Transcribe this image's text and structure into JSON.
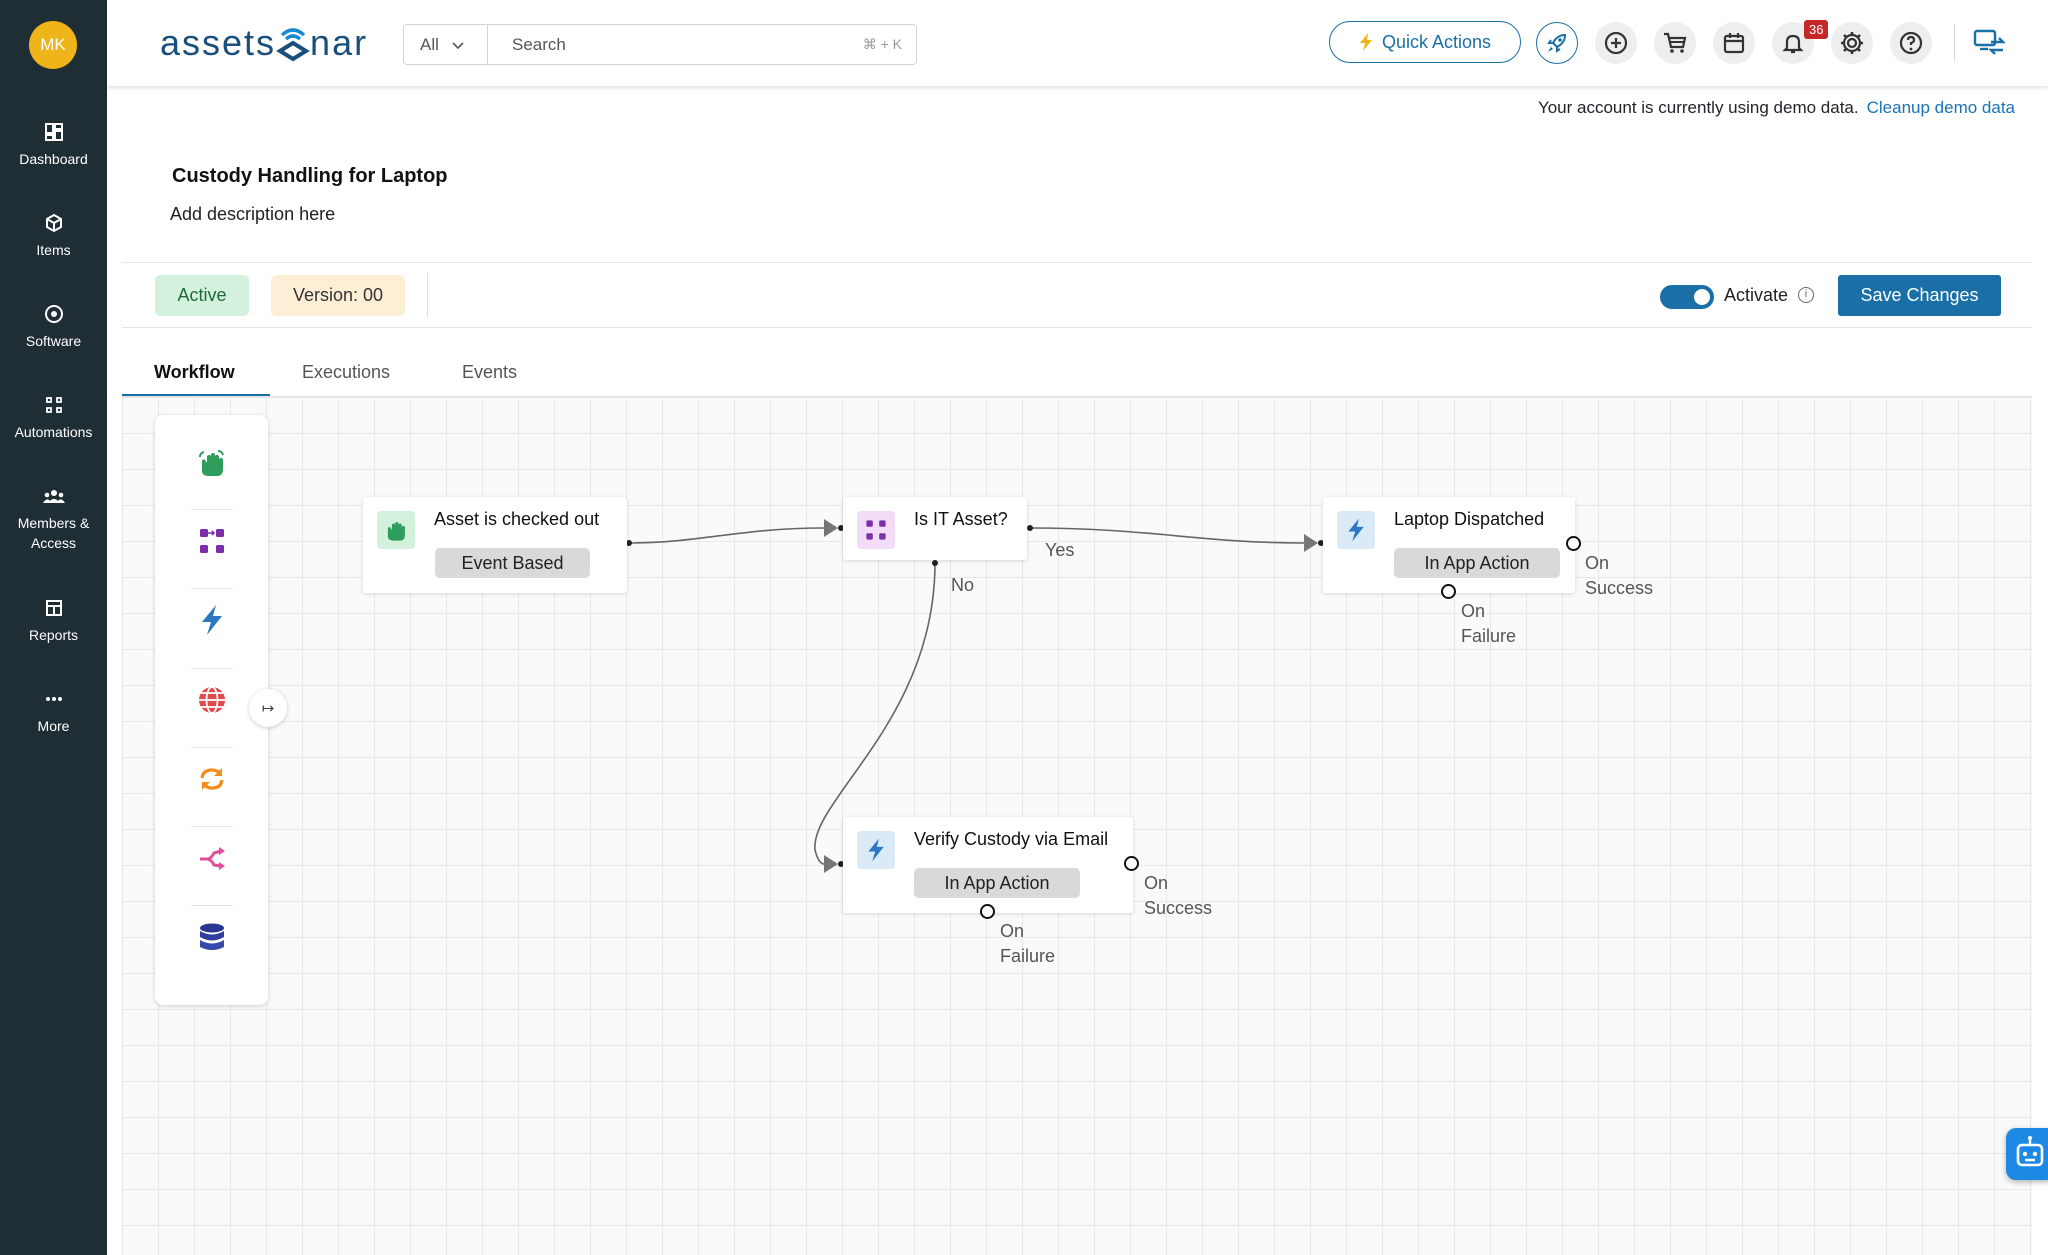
{
  "user": {
    "initials": "MK"
  },
  "sidebar": {
    "items": [
      {
        "label": "Dashboard"
      },
      {
        "label": "Items"
      },
      {
        "label": "Software"
      },
      {
        "label": "Automations"
      },
      {
        "label": "Members &"
      },
      {
        "label": "Access"
      },
      {
        "label": "Reports"
      },
      {
        "label": "More"
      }
    ]
  },
  "header": {
    "logo_text_left": "assets",
    "logo_text_right": "nar",
    "search_scope": "All",
    "search_placeholder": "Search",
    "search_shortcut": "⌘ + K",
    "quick_actions": "Quick Actions",
    "notifications_count": "36",
    "icons": [
      "rocket-icon",
      "add-circle-icon",
      "cart-icon",
      "calendar-icon",
      "bell-icon",
      "gear-icon",
      "help-icon",
      "transfer-icon"
    ]
  },
  "demo_notice": {
    "text": "Your account is currently using demo data.",
    "link": "Cleanup demo data"
  },
  "automation": {
    "title": "Custody Handling for Laptop",
    "description": "Add description here",
    "status": "Active",
    "version": "Version: 00",
    "activate_label": "Activate",
    "activated": true,
    "save_label": "Save Changes"
  },
  "tabs": [
    {
      "label": "Workflow",
      "active": true
    },
    {
      "label": "Executions",
      "active": false
    },
    {
      "label": "Events",
      "active": false
    }
  ],
  "palette": {
    "items": [
      "hand-icon",
      "workflow-icon",
      "lightning-icon",
      "globe-icon",
      "refresh-icon",
      "shuffle-icon",
      "database-icon"
    ],
    "expand_symbol": "↦"
  },
  "workflow": {
    "nodes": [
      {
        "title": "Asset is checked out",
        "tag": "Event Based",
        "icon": "hand-icon"
      },
      {
        "title": "Is IT Asset?",
        "icon": "workflow-icon"
      },
      {
        "title": "Laptop Dispatched",
        "tag": "In App Action",
        "icon": "lightning-icon"
      },
      {
        "title": "Verify Custody via Email",
        "tag": "In App Action",
        "icon": "lightning-icon"
      }
    ],
    "edge_labels": {
      "yes": "Yes",
      "no": "No"
    },
    "port_labels": {
      "on": "On",
      "success": "Success",
      "failure": "Failure"
    }
  },
  "colors": {
    "sidebar": "#1f2d34",
    "primary": "#1a6fa6",
    "avatar": "#f0b41b",
    "active_chip": "#d4f1de",
    "version_chip": "#fdefd6"
  }
}
